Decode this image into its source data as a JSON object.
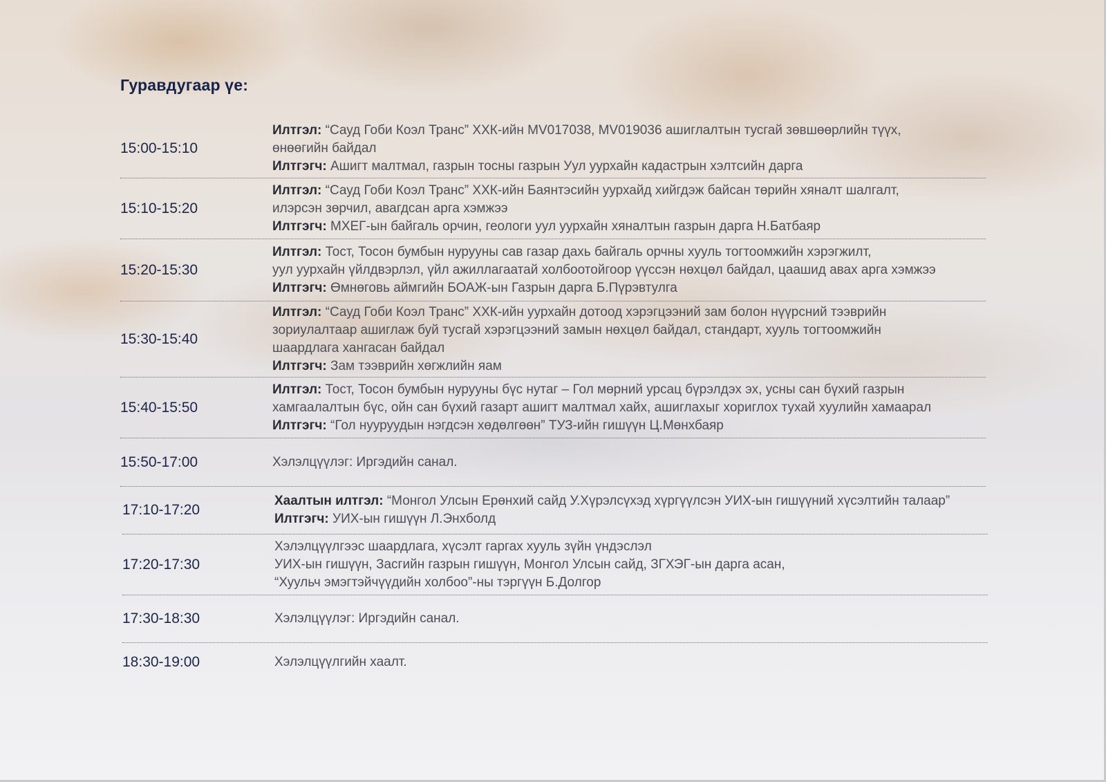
{
  "heading": "Гуравдугаар үе:",
  "rows": [
    {
      "time": "15:00-15:10",
      "lines": [
        {
          "label": "Илтгэл:",
          "text": " “Сауд Гоби Коэл Транс” ХХК-ийн MV017038,  MV019036 ашиглалтын тусгай зөвшөөрлийн түүх,"
        },
        {
          "label": "",
          "text": "өнөөгийн байдал"
        },
        {
          "label": "Илтгэгч:",
          "text": " Ашигт малтмал, газрын тосны газрын Уул уурхайн кадастрын хэлтсийн дарга"
        }
      ]
    },
    {
      "time": "15:10-15:20",
      "lines": [
        {
          "label": "Илтгэл:",
          "text": " “Сауд Гоби Коэл Транс” ХХК-ийн Баянтэсийн уурхайд хийгдэж байсан төрийн хяналт шалгалт,"
        },
        {
          "label": "",
          "text": "илэрсэн зөрчил, авагдсан арга хэмжээ"
        },
        {
          "label": "Илтгэгч:",
          "text": " МХЕГ-ын байгаль орчин, геологи уул уурхайн хяналтын газрын дарга Н.Батбаяр"
        }
      ]
    },
    {
      "time": "15:20-15:30",
      "lines": [
        {
          "label": "Илтгэл:",
          "text": " Тост, Тосон бумбын нурууны сав газар дахь байгаль орчны хууль тогтоомжийн хэрэгжилт,"
        },
        {
          "label": "",
          "text": "уул уурхайн үйлдвэрлэл, үйл ажиллагаатай холбоотойгоор үүссэн нөхцөл байдал, цаашид авах арга хэмжээ"
        },
        {
          "label": "Илтгэгч:",
          "text": " Өмнөговь аймгийн БОАЖ-ын Газрын дарга Б.Пүрэвтулга"
        }
      ]
    },
    {
      "time": "15:30-15:40",
      "lines": [
        {
          "label": "Илтгэл:",
          "text": " “Сауд Гоби Коэл Транс” ХХК-ийн уурхайн дотоод хэрэгцээний зам болон нүүрсний тээврийн"
        },
        {
          "label": "",
          "text": "зориулалтаар ашиглаж буй тусгай хэрэгцээний замын нөхцөл байдал, стандарт, хууль тогтоомжийн"
        },
        {
          "label": "",
          "text": "шаардлага хангасан байдал"
        },
        {
          "label": "Илтгэгч:",
          "text": " Зам тээврийн хөгжлийн яам"
        }
      ]
    },
    {
      "time": "15:40-15:50",
      "lines": [
        {
          "label": "Илтгэл:",
          "text": " Тост, Тосон бумбын нурууны бүс нутаг – Гол мөрний урсац бүрэлдэх эх, усны сан бүхий газрын"
        },
        {
          "label": "",
          "text": "хамгаалалтын бүс, ойн сан бүхий газарт ашигт малтмал хайх, ашиглахыг хориглох тухай хуулийн хамаарал"
        },
        {
          "label": "Илтгэгч:",
          "text": " “Гол нууруудын нэгдсэн хөдөлгөөн” ТУЗ-ийн гишүүн Ц.Мөнхбаяр"
        }
      ]
    },
    {
      "time": "15:50-17:00",
      "lines": [
        {
          "label": "",
          "text": "Хэлэлцүүлэг: Иргэдийн санал."
        }
      ]
    },
    {
      "time": "17:10-17:20",
      "lines": [
        {
          "label": "Хаалтын илтгэл:",
          "text": " “Монгол Улсын Ерөнхий сайд У.Хүрэлсүхэд хүргүүлсэн УИХ-ын гишүүний хүсэлтийн талаар”"
        },
        {
          "label": "Илтгэгч:",
          "text": " УИХ-ын гишүүн Л.Энхболд"
        }
      ]
    },
    {
      "time": "17:20-17:30",
      "lines": [
        {
          "label": "",
          "text": "Хэлэлцүүлгээс шаардлага, хүсэлт гаргах хууль зүйн үндэслэл"
        },
        {
          "label": "",
          "text": "УИХ-ын гишүүн, Засгийн газрын гишүүн, Монгол Улсын сайд, ЗГХЭГ-ын дарга асан,"
        },
        {
          "label": "",
          "text": "“Хуульч эмэгтэйчүүдийн холбоо”-ны тэргүүн Б.Долгор"
        }
      ]
    },
    {
      "time": "17:30-18:30",
      "lines": [
        {
          "label": "",
          "text": "Хэлэлцүүлэг: Иргэдийн санал."
        }
      ]
    },
    {
      "time": "18:30-19:00",
      "lines": [
        {
          "label": "",
          "text": "Хэлэлцүүлгийн хаалт."
        }
      ]
    }
  ]
}
